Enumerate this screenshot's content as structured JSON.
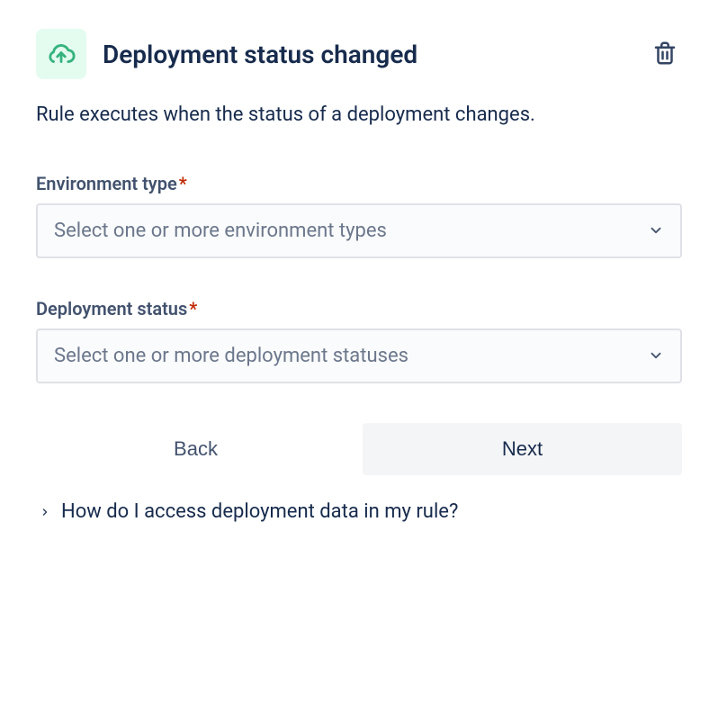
{
  "header": {
    "title": "Deployment status changed"
  },
  "description": "Rule executes when the status of a deployment changes.",
  "fields": {
    "environment_type": {
      "label": "Environment type",
      "required_mark": "*",
      "placeholder": "Select one or more environment types"
    },
    "deployment_status": {
      "label": "Deployment status",
      "required_mark": "*",
      "placeholder": "Select one or more deployment statuses"
    }
  },
  "buttons": {
    "back": "Back",
    "next": "Next"
  },
  "help": {
    "text": "How do I access deployment data in my rule?"
  }
}
